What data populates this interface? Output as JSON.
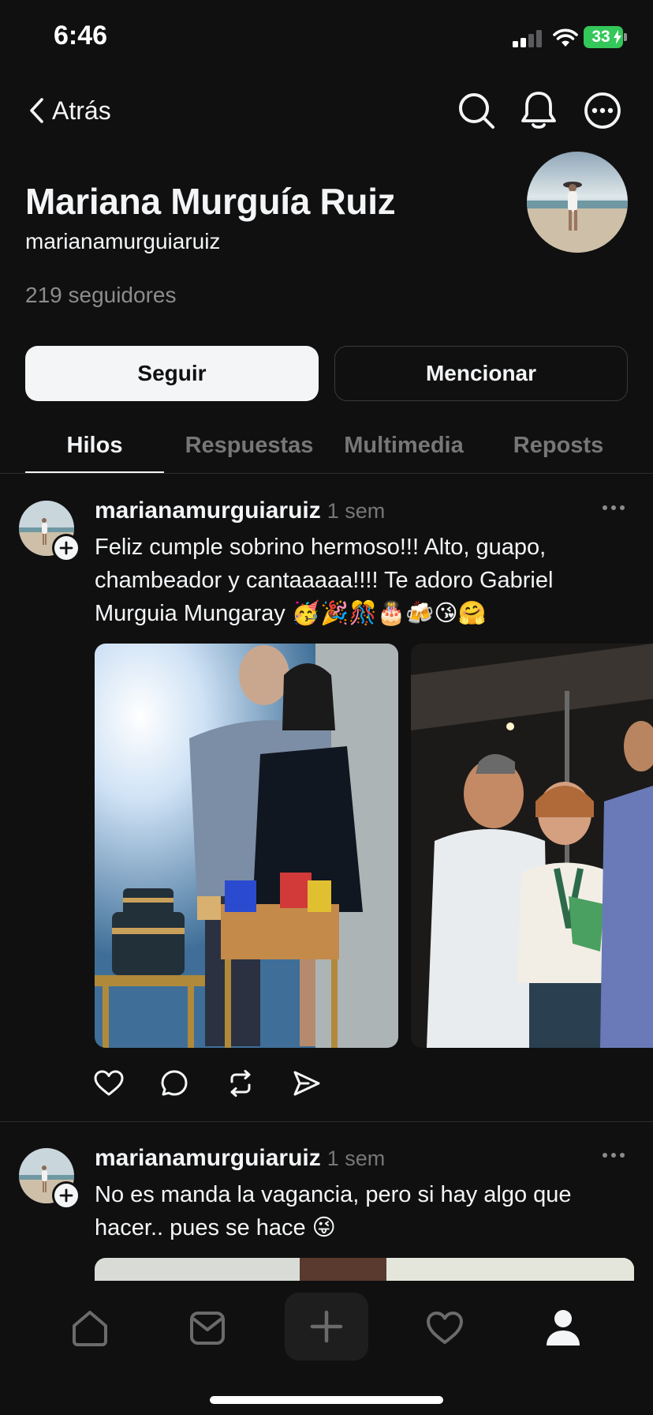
{
  "status_bar": {
    "time": "6:46",
    "battery": "33"
  },
  "nav": {
    "back_label": "Atrás"
  },
  "profile": {
    "name": "Mariana Murguía Ruiz",
    "handle": "marianamurguiaruiz",
    "followers": "219 seguidores",
    "follow_label": "Seguir",
    "mention_label": "Mencionar"
  },
  "tabs": [
    {
      "label": "Hilos",
      "active": true
    },
    {
      "label": "Respuestas",
      "active": false
    },
    {
      "label": "Multimedia",
      "active": false
    },
    {
      "label": "Reposts",
      "active": false
    }
  ],
  "posts": [
    {
      "username": "marianamurguiaruiz",
      "time": "1 sem",
      "text": "Feliz cumple sobrino hermoso!!! Alto, guapo, chambeador y cantaaaaa!!!! Te adoro Gabriel Murguia Mungaray 🥳🎉🎊🎂🍻😘🤗"
    },
    {
      "username": "marianamurguiaruiz",
      "time": "1 sem",
      "text": "No es manda la vagancia, pero si hay algo que hacer.. pues se hace 😜"
    }
  ],
  "icons": {
    "back": "chevron-left-icon",
    "search": "search-icon",
    "notifications": "bell-icon",
    "more": "more-circle-icon",
    "like": "heart-icon",
    "comment": "comment-icon",
    "repost": "repost-icon",
    "share": "send-icon",
    "tab_home": "home-icon",
    "tab_inbox": "inbox-icon",
    "tab_create": "plus-icon",
    "tab_activity": "heart-icon",
    "tab_profile": "profile-icon"
  },
  "colors": {
    "background": "#101010",
    "text_primary": "#f3f5f7",
    "text_secondary": "#777777",
    "battery": "#34c759"
  }
}
